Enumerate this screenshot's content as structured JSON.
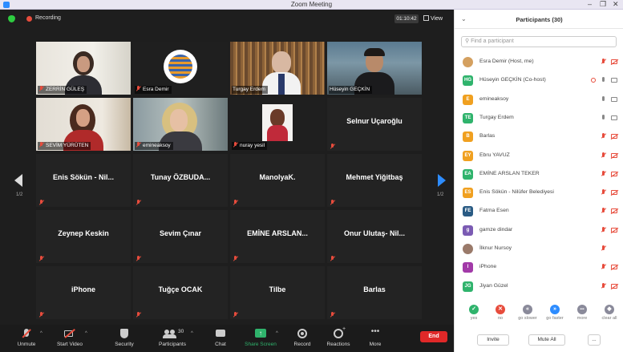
{
  "window": {
    "title": "Zoom Meeting",
    "controls": [
      "–",
      "❐",
      "✕"
    ]
  },
  "topbar": {
    "recording_label": "Recording",
    "timer": "01:10:42",
    "view_label": "View"
  },
  "pager": {
    "left": "1/2",
    "right": "1/2"
  },
  "tiles": [
    {
      "name": "ZERRİN GÜLEŞ",
      "video": true
    },
    {
      "name": "Esra Demir",
      "video": true
    },
    {
      "name": "Turgay Erdem",
      "video": true
    },
    {
      "name": "Hüseyin GEÇKİN",
      "video": true
    },
    {
      "name": "SEVİM YÜRÜTEN",
      "video": true
    },
    {
      "name": "emineaksoy",
      "video": true
    },
    {
      "name": "nuray yesil",
      "video": true
    },
    {
      "name": "Selnur Uçaroğlu",
      "video": false
    },
    {
      "name": "Enis Sökün - Nil...",
      "video": false
    },
    {
      "name": "Tunay ÖZBUDA...",
      "video": false
    },
    {
      "name": "ManolyaK.",
      "video": false
    },
    {
      "name": "Mehmet Yiğitbaş",
      "video": false
    },
    {
      "name": "Zeynep Keskin",
      "video": false
    },
    {
      "name": "Sevim Çınar",
      "video": false
    },
    {
      "name": "EMİNE ARSLAN...",
      "video": false
    },
    {
      "name": "Onur Ulutaş- Nil...",
      "video": false
    },
    {
      "name": "iPhone",
      "video": false
    },
    {
      "name": "Tuğçe OCAK",
      "video": false
    },
    {
      "name": "Tilbe",
      "video": false
    },
    {
      "name": "Barlas",
      "video": false
    }
  ],
  "toolbar": {
    "unmute": "Unmute",
    "start_video": "Start Video",
    "security": "Security",
    "participants": "Participants",
    "participants_count": "30",
    "chat": "Chat",
    "share_screen": "Share Screen",
    "record": "Record",
    "reactions": "Reactions",
    "more": "More",
    "end": "End"
  },
  "panel": {
    "title": "Participants (30)",
    "search_placeholder": "Find a participant",
    "participants": [
      {
        "initials": "",
        "name": "Esra Demir (Host, me)",
        "color": "#d4a060",
        "mic": "muted",
        "cam": "off"
      },
      {
        "initials": "HG",
        "name": "Hüseyin GEÇKİN (Co-host)",
        "color": "#2fb36c",
        "mic": "on",
        "cam": "on"
      },
      {
        "initials": "E",
        "name": "emineaksoy",
        "color": "#f0a020",
        "mic": "on",
        "cam": "on"
      },
      {
        "initials": "TE",
        "name": "Turgay Erdem",
        "color": "#2fb36c",
        "mic": "on",
        "cam": "on"
      },
      {
        "initials": "B",
        "name": "Barlas",
        "color": "#f0a020",
        "mic": "muted",
        "cam": "off"
      },
      {
        "initials": "EY",
        "name": "Ebru YAVUZ",
        "color": "#f0a020",
        "mic": "muted",
        "cam": "off"
      },
      {
        "initials": "EA",
        "name": "EMİNE ARSLAN TEKER",
        "color": "#2fb36c",
        "mic": "muted",
        "cam": "off"
      },
      {
        "initials": "ES",
        "name": "Enis Sökün - Nilüfer Belediyesi",
        "color": "#f0a020",
        "mic": "muted",
        "cam": "off"
      },
      {
        "initials": "FE",
        "name": "Fatma Esen",
        "color": "#2a5b84",
        "mic": "muted",
        "cam": "off"
      },
      {
        "initials": "g",
        "name": "gamze dindar",
        "color": "#7b5bb3",
        "mic": "muted",
        "cam": "off"
      },
      {
        "initials": "",
        "name": "İlknur Nursoy",
        "color": "#9a7a6a",
        "mic": "muted",
        "cam": "none"
      },
      {
        "initials": "I",
        "name": "iPhone",
        "color": "#a23aa8",
        "mic": "muted",
        "cam": "off"
      },
      {
        "initials": "JG",
        "name": "Jiyan Güzel",
        "color": "#2fb36c",
        "mic": "muted",
        "cam": "off"
      }
    ],
    "reactions": [
      {
        "label": "yes",
        "glyph": "✓",
        "color": "#2fb36c"
      },
      {
        "label": "no",
        "glyph": "✕",
        "color": "#e74c3c"
      },
      {
        "label": "go slower",
        "glyph": "«",
        "color": "#8a8a9a"
      },
      {
        "label": "go faster",
        "glyph": "»",
        "color": "#2d8cff"
      },
      {
        "label": "more",
        "glyph": "•••",
        "color": "#8a8a9a"
      },
      {
        "label": "clear all",
        "glyph": "◆",
        "color": "#8a8a9a"
      }
    ],
    "invite": "Invite",
    "mute_all": "Mute All",
    "more": "..."
  }
}
